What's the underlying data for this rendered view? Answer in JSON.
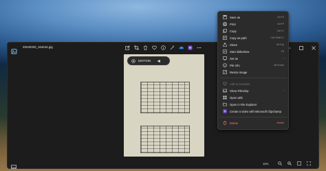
{
  "window": {
    "file_name": "20240320_164244.jpg",
    "motion_label": "MOTION",
    "zoom": "11%"
  },
  "menu": {
    "items": [
      {
        "label": "Save as",
        "shortcut": "Ctrl+S",
        "icon": "save-icon"
      },
      {
        "label": "Print",
        "shortcut": "Ctrl+P",
        "icon": "print-icon"
      },
      {
        "label": "Copy",
        "shortcut": "Ctrl+C",
        "icon": "copy-icon"
      },
      {
        "label": "Copy as path",
        "shortcut": "Ctrl+Shift+C",
        "icon": "copy-path-icon"
      },
      {
        "label": "Share",
        "shortcut": "Alt+Up",
        "icon": "share-icon"
      },
      {
        "label": "Start slideshow",
        "shortcut": "F5",
        "icon": "slideshow-icon"
      },
      {
        "label": "Set as",
        "shortcut": "",
        "icon": "set-as-icon"
      },
      {
        "label": "File info",
        "shortcut": "Alt+Enter",
        "icon": "info-icon"
      },
      {
        "label": "Resize image",
        "shortcut": "",
        "icon": "resize-icon"
      },
      {
        "label": "Add to favorites",
        "shortcut": "",
        "icon": "heart-icon"
      },
      {
        "label": "Show Filmstrip",
        "shortcut": "",
        "icon": "filmstrip-icon"
      },
      {
        "label": "Open with",
        "shortcut": "",
        "icon": "open-with-icon"
      },
      {
        "label": "Open in File Explorer",
        "shortcut": "",
        "icon": "folder-icon"
      },
      {
        "label": "Create a video with Microsoft Clipchamp",
        "shortcut": "",
        "icon": "clipchamp-icon"
      },
      {
        "label": "Delete",
        "shortcut": "Delete",
        "icon": "trash-icon"
      }
    ]
  },
  "colors": {
    "accent": "#4cc2ff",
    "danger": "#ff7b73",
    "menu_bg": "#2b2b2b",
    "window_bg": "#1c1c1c"
  }
}
